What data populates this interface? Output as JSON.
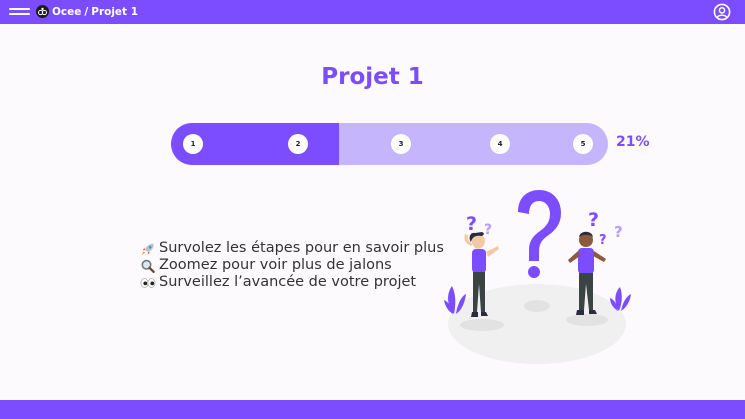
{
  "topbar": {
    "breadcrumb": {
      "app": "Ocee",
      "separator": "/",
      "page": "Projet 1"
    },
    "icons": {
      "menu": "hamburger-menu-icon",
      "logo": "ocee-logo-icon",
      "account": "account-circle-icon"
    }
  },
  "project": {
    "title": "Projet 1",
    "progress_percent": 21,
    "progress_label": "21%",
    "completed_fraction": 0.385,
    "steps": [
      {
        "label": "1",
        "completed": true
      },
      {
        "label": "2",
        "completed": true
      },
      {
        "label": "3",
        "completed": false
      },
      {
        "label": "4",
        "completed": false
      },
      {
        "label": "5",
        "completed": false
      }
    ]
  },
  "tips": [
    {
      "icon": "rocket-icon",
      "text": "Survolez les étapes pour en savoir plus"
    },
    {
      "icon": "magnifier-icon",
      "text": "Zoomez pour voir plus de jalons"
    },
    {
      "icon": "eyes-icon",
      "text": "Surveillez l’avancée de votre projet"
    }
  ],
  "illustration": {
    "name": "confused-people-question-marks-illustration"
  },
  "colors": {
    "primary": "#7c4dff",
    "track_remaining": "#c5b5fd",
    "background": "#fdfafe",
    "text": "#333333"
  }
}
